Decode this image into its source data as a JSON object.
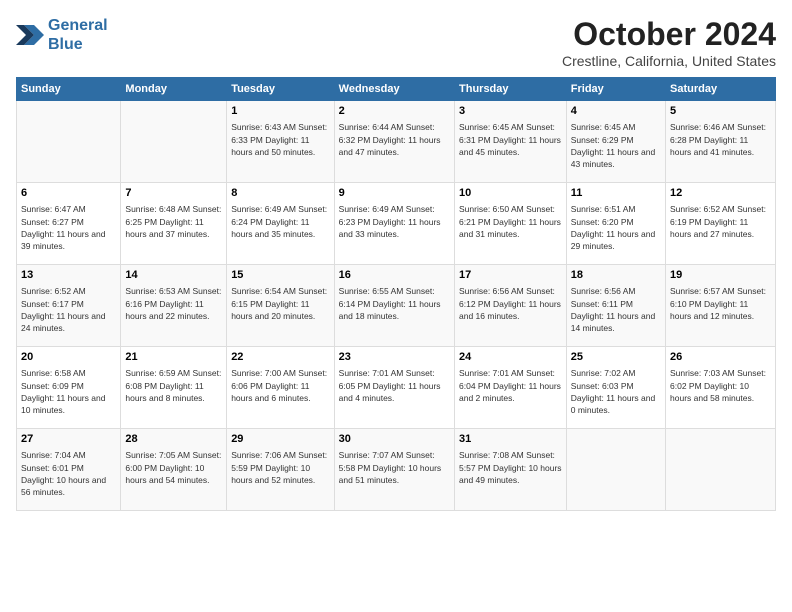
{
  "header": {
    "logo_line1": "General",
    "logo_line2": "Blue",
    "main_title": "October 2024",
    "subtitle": "Crestline, California, United States"
  },
  "days_of_week": [
    "Sunday",
    "Monday",
    "Tuesday",
    "Wednesday",
    "Thursday",
    "Friday",
    "Saturday"
  ],
  "weeks": [
    [
      {
        "day": "",
        "info": ""
      },
      {
        "day": "",
        "info": ""
      },
      {
        "day": "1",
        "info": "Sunrise: 6:43 AM\nSunset: 6:33 PM\nDaylight: 11 hours and 50 minutes."
      },
      {
        "day": "2",
        "info": "Sunrise: 6:44 AM\nSunset: 6:32 PM\nDaylight: 11 hours and 47 minutes."
      },
      {
        "day": "3",
        "info": "Sunrise: 6:45 AM\nSunset: 6:31 PM\nDaylight: 11 hours and 45 minutes."
      },
      {
        "day": "4",
        "info": "Sunrise: 6:45 AM\nSunset: 6:29 PM\nDaylight: 11 hours and 43 minutes."
      },
      {
        "day": "5",
        "info": "Sunrise: 6:46 AM\nSunset: 6:28 PM\nDaylight: 11 hours and 41 minutes."
      }
    ],
    [
      {
        "day": "6",
        "info": "Sunrise: 6:47 AM\nSunset: 6:27 PM\nDaylight: 11 hours and 39 minutes."
      },
      {
        "day": "7",
        "info": "Sunrise: 6:48 AM\nSunset: 6:25 PM\nDaylight: 11 hours and 37 minutes."
      },
      {
        "day": "8",
        "info": "Sunrise: 6:49 AM\nSunset: 6:24 PM\nDaylight: 11 hours and 35 minutes."
      },
      {
        "day": "9",
        "info": "Sunrise: 6:49 AM\nSunset: 6:23 PM\nDaylight: 11 hours and 33 minutes."
      },
      {
        "day": "10",
        "info": "Sunrise: 6:50 AM\nSunset: 6:21 PM\nDaylight: 11 hours and 31 minutes."
      },
      {
        "day": "11",
        "info": "Sunrise: 6:51 AM\nSunset: 6:20 PM\nDaylight: 11 hours and 29 minutes."
      },
      {
        "day": "12",
        "info": "Sunrise: 6:52 AM\nSunset: 6:19 PM\nDaylight: 11 hours and 27 minutes."
      }
    ],
    [
      {
        "day": "13",
        "info": "Sunrise: 6:52 AM\nSunset: 6:17 PM\nDaylight: 11 hours and 24 minutes."
      },
      {
        "day": "14",
        "info": "Sunrise: 6:53 AM\nSunset: 6:16 PM\nDaylight: 11 hours and 22 minutes."
      },
      {
        "day": "15",
        "info": "Sunrise: 6:54 AM\nSunset: 6:15 PM\nDaylight: 11 hours and 20 minutes."
      },
      {
        "day": "16",
        "info": "Sunrise: 6:55 AM\nSunset: 6:14 PM\nDaylight: 11 hours and 18 minutes."
      },
      {
        "day": "17",
        "info": "Sunrise: 6:56 AM\nSunset: 6:12 PM\nDaylight: 11 hours and 16 minutes."
      },
      {
        "day": "18",
        "info": "Sunrise: 6:56 AM\nSunset: 6:11 PM\nDaylight: 11 hours and 14 minutes."
      },
      {
        "day": "19",
        "info": "Sunrise: 6:57 AM\nSunset: 6:10 PM\nDaylight: 11 hours and 12 minutes."
      }
    ],
    [
      {
        "day": "20",
        "info": "Sunrise: 6:58 AM\nSunset: 6:09 PM\nDaylight: 11 hours and 10 minutes."
      },
      {
        "day": "21",
        "info": "Sunrise: 6:59 AM\nSunset: 6:08 PM\nDaylight: 11 hours and 8 minutes."
      },
      {
        "day": "22",
        "info": "Sunrise: 7:00 AM\nSunset: 6:06 PM\nDaylight: 11 hours and 6 minutes."
      },
      {
        "day": "23",
        "info": "Sunrise: 7:01 AM\nSunset: 6:05 PM\nDaylight: 11 hours and 4 minutes."
      },
      {
        "day": "24",
        "info": "Sunrise: 7:01 AM\nSunset: 6:04 PM\nDaylight: 11 hours and 2 minutes."
      },
      {
        "day": "25",
        "info": "Sunrise: 7:02 AM\nSunset: 6:03 PM\nDaylight: 11 hours and 0 minutes."
      },
      {
        "day": "26",
        "info": "Sunrise: 7:03 AM\nSunset: 6:02 PM\nDaylight: 10 hours and 58 minutes."
      }
    ],
    [
      {
        "day": "27",
        "info": "Sunrise: 7:04 AM\nSunset: 6:01 PM\nDaylight: 10 hours and 56 minutes."
      },
      {
        "day": "28",
        "info": "Sunrise: 7:05 AM\nSunset: 6:00 PM\nDaylight: 10 hours and 54 minutes."
      },
      {
        "day": "29",
        "info": "Sunrise: 7:06 AM\nSunset: 5:59 PM\nDaylight: 10 hours and 52 minutes."
      },
      {
        "day": "30",
        "info": "Sunrise: 7:07 AM\nSunset: 5:58 PM\nDaylight: 10 hours and 51 minutes."
      },
      {
        "day": "31",
        "info": "Sunrise: 7:08 AM\nSunset: 5:57 PM\nDaylight: 10 hours and 49 minutes."
      },
      {
        "day": "",
        "info": ""
      },
      {
        "day": "",
        "info": ""
      }
    ]
  ]
}
